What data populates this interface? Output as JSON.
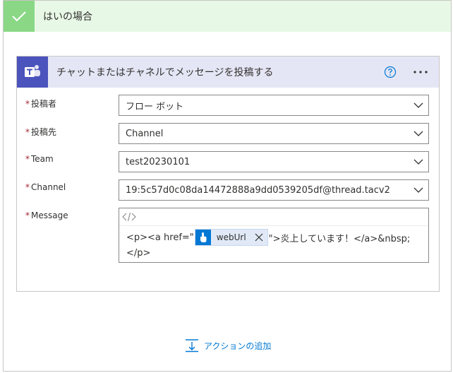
{
  "condition": {
    "title": "はいの場合",
    "color": "#8ad886"
  },
  "action": {
    "title": "チャットまたはチャネルでメッセージを投稿する",
    "icon": "teams-icon",
    "brand_color": "#4b53bc"
  },
  "fields": {
    "poster": {
      "label": "投稿者",
      "value": "フロー ボット"
    },
    "post_in": {
      "label": "投稿先",
      "value": "Channel"
    },
    "team": {
      "label": "Team",
      "value": "test20230101"
    },
    "channel": {
      "label": "Channel",
      "value": "19:5c57d0c08da14472888a9dd0539205df@thread.tacv2"
    },
    "message": {
      "label": "Message",
      "before_token": "<p><a href=\"",
      "token_label": "webUrl",
      "after_token": "\">炎上しています！</a>&nbsp;",
      "line2": "</p>"
    }
  },
  "required_mark": "*",
  "add_action": {
    "label": "アクションの追加"
  }
}
